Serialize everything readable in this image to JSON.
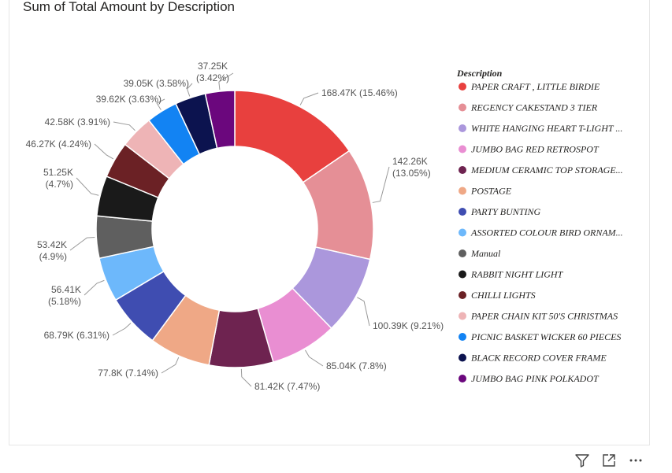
{
  "visual": {
    "title": "Sum of Total Amount by Description",
    "icons": [
      "filter-icon",
      "focus-mode-icon",
      "more-options-icon"
    ]
  },
  "chart_data": {
    "type": "pie",
    "donut": true,
    "title": "Sum of Total Amount by Description",
    "legend_title": "Description",
    "legend_position": "right",
    "slices": [
      {
        "label": "PAPER CRAFT , LITTLE BIRDIE",
        "legend_text": "PAPER CRAFT , LITTLE BIRDIE",
        "value": 168.47,
        "value_label": "168.47K",
        "percent_label": "(15.46%)",
        "color": "#E8403E"
      },
      {
        "label": "REGENCY CAKESTAND 3 TIER",
        "legend_text": "REGENCY CAKESTAND 3 TIER",
        "value": 142.26,
        "value_label": "142.26K",
        "percent_label": "(13.05%)",
        "color": "#E58F96"
      },
      {
        "label": "WHITE HANGING HEART T-LIGHT HOLDER",
        "legend_text": "WHITE HANGING HEART T-LIGHT ...",
        "value": 100.39,
        "value_label": "100.39K",
        "percent_label": "(9.21%)",
        "color": "#AB97DC"
      },
      {
        "label": "JUMBO BAG RED RETROSPOT",
        "legend_text": "JUMBO BAG RED RETROSPOT",
        "value": 85.04,
        "value_label": "85.04K",
        "percent_label": "(7.8%)",
        "color": "#E98ED2"
      },
      {
        "label": "MEDIUM CERAMIC TOP STORAGE JAR",
        "legend_text": "MEDIUM CERAMIC TOP STORAGE...",
        "value": 81.42,
        "value_label": "81.42K",
        "percent_label": "(7.47%)",
        "color": "#6E2350"
      },
      {
        "label": "POSTAGE",
        "legend_text": "POSTAGE",
        "value": 77.8,
        "value_label": "77.8K",
        "percent_label": "(7.14%)",
        "color": "#EFA886"
      },
      {
        "label": "PARTY BUNTING",
        "legend_text": "PARTY BUNTING",
        "value": 68.79,
        "value_label": "68.79K",
        "percent_label": "(6.31%)",
        "color": "#3F4DB1"
      },
      {
        "label": "ASSORTED COLOUR BIRD ORNAMENT",
        "legend_text": "ASSORTED COLOUR BIRD ORNAM...",
        "value": 56.41,
        "value_label": "56.41K",
        "percent_label": "(5.18%)",
        "color": "#6DB8FB"
      },
      {
        "label": "Manual",
        "legend_text": "Manual",
        "value": 53.42,
        "value_label": "53.42K",
        "percent_label": "(4.9%)",
        "color": "#5F5F5F"
      },
      {
        "label": "RABBIT NIGHT LIGHT",
        "legend_text": "RABBIT NIGHT LIGHT",
        "value": 51.25,
        "value_label": "51.25K",
        "percent_label": "(4.7%)",
        "color": "#1A1A1A"
      },
      {
        "label": "CHILLI LIGHTS",
        "legend_text": "CHILLI LIGHTS",
        "value": 46.27,
        "value_label": "46.27K",
        "percent_label": "(4.24%)",
        "color": "#6B2125"
      },
      {
        "label": "PAPER CHAIN KIT 50'S CHRISTMAS",
        "legend_text": "PAPER CHAIN KIT 50'S CHRISTMAS",
        "value": 42.58,
        "value_label": "42.58K",
        "percent_label": "(3.91%)",
        "color": "#EEB4B6"
      },
      {
        "label": "PICNIC BASKET WICKER 60 PIECES",
        "legend_text": "PICNIC BASKET WICKER 60 PIECES",
        "value": 39.62,
        "value_label": "39.62K",
        "percent_label": "(3.63%)",
        "color": "#1283F3"
      },
      {
        "label": "BLACK RECORD COVER FRAME",
        "legend_text": "BLACK RECORD COVER FRAME",
        "value": 39.05,
        "value_label": "39.05K",
        "percent_label": "(3.58%)",
        "color": "#0C134F"
      },
      {
        "label": "JUMBO BAG PINK POLKADOT",
        "legend_text": "JUMBO BAG PINK POLKADOT",
        "value": 37.25,
        "value_label": "37.25K",
        "percent_label": "(3.42%)",
        "color": "#6B077D"
      }
    ]
  }
}
